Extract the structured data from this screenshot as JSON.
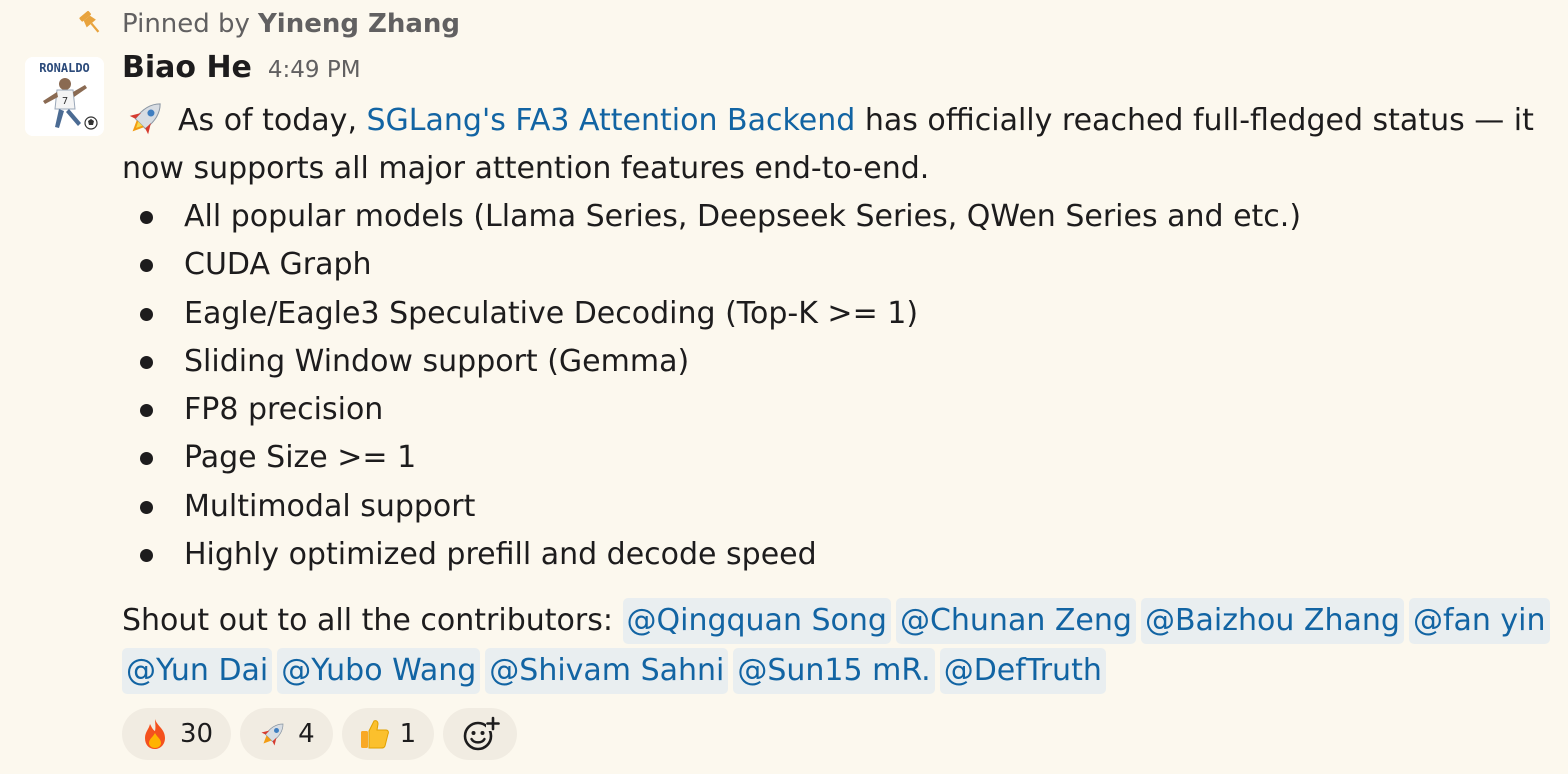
{
  "pinned": {
    "prefix": "Pinned by",
    "by": "Yineng Zhang"
  },
  "message": {
    "author": "Biao He",
    "avatar_text": "RONALDO",
    "time": "4:49 PM",
    "intro_before_link": "As of today, ",
    "link_text": "SGLang's FA3 Attention Backend",
    "intro_after_link": " has officially reached full-fledged status — it now supports all major attention features end-to-end.",
    "features": [
      "All popular models (Llama Series, Deepseek Series, QWen Series and etc.)",
      "CUDA Graph",
      "Eagle/Eagle3 Speculative Decoding (Top-K >= 1)",
      "Sliding Window support (Gemma)",
      "FP8 precision",
      "Page Size >= 1",
      "Multimodal support",
      "Highly optimized prefill and decode speed"
    ],
    "shoutout_label": "Shout out to all the contributors:",
    "mentions": [
      "@Qingquan Song",
      "@Chunan Zeng",
      "@Baizhou Zhang",
      "@fan yin",
      "@Yun Dai",
      "@Yubo Wang",
      "@Shivam Sahni",
      "@Sun15 mR.",
      "@DefTruth"
    ]
  },
  "reactions": [
    {
      "icon": "fire-icon",
      "count": "30"
    },
    {
      "icon": "rocket-icon",
      "count": "4"
    },
    {
      "icon": "thumbs-up-icon",
      "count": "1"
    }
  ],
  "colors": {
    "background": "#fcf8ee",
    "link": "#1264a3",
    "mention_bg": "#e9eef0",
    "reaction_bg": "#f1ece2",
    "pin": "#e8a33d"
  }
}
